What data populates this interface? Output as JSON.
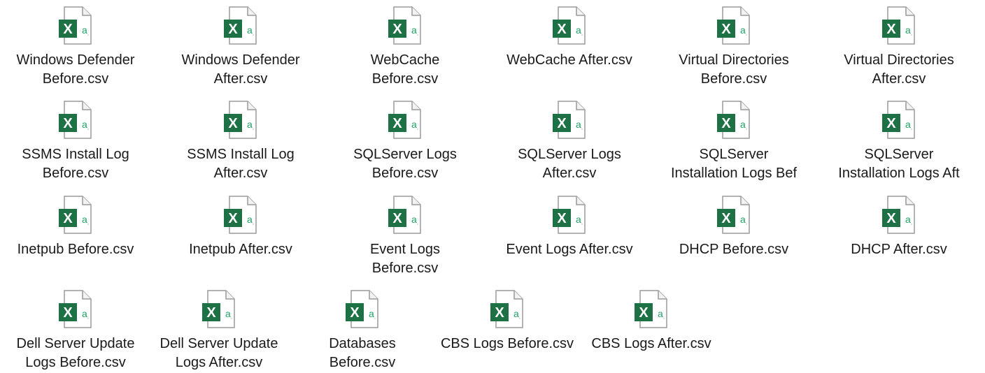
{
  "files": [
    {
      "label": "Windows Defender\nBefore.csv",
      "icon": "excel-csv-icon"
    },
    {
      "label": "Windows Defender\nAfter.csv",
      "icon": "excel-csv-icon"
    },
    {
      "label": "WebCache\nBefore.csv",
      "icon": "excel-csv-icon"
    },
    {
      "label": "WebCache After.csv",
      "icon": "excel-csv-icon"
    },
    {
      "label": "Virtual Directories\nBefore.csv",
      "icon": "excel-csv-icon"
    },
    {
      "label": "Virtual Directories\nAfter.csv",
      "icon": "excel-csv-icon"
    },
    {
      "label": "SSMS Install Log\nBefore.csv",
      "icon": "excel-csv-icon"
    },
    {
      "label": "SSMS Install Log\nAfter.csv",
      "icon": "excel-csv-icon"
    },
    {
      "label": "SQLServer Logs\nBefore.csv",
      "icon": "excel-csv-icon"
    },
    {
      "label": "SQLServer Logs\nAfter.csv",
      "icon": "excel-csv-icon"
    },
    {
      "label": "SQLServer\nInstallation Logs Bef",
      "icon": "excel-csv-icon"
    },
    {
      "label": "SQLServer\nInstallation Logs Aft",
      "icon": "excel-csv-icon"
    },
    {
      "label": "Inetpub Before.csv",
      "icon": "excel-csv-icon"
    },
    {
      "label": "Inetpub After.csv",
      "icon": "excel-csv-icon"
    },
    {
      "label": "Event Logs\nBefore.csv",
      "icon": "excel-csv-icon"
    },
    {
      "label": "Event Logs After.csv",
      "icon": "excel-csv-icon"
    },
    {
      "label": "DHCP Before.csv",
      "icon": "excel-csv-icon"
    },
    {
      "label": "DHCP After.csv",
      "icon": "excel-csv-icon"
    },
    {
      "label": "Dell Server Update\nLogs Before.csv",
      "icon": "excel-csv-icon"
    },
    {
      "label": "Dell Server Update\nLogs After.csv",
      "icon": "excel-csv-icon"
    },
    {
      "label": "Databases\nBefore.csv",
      "icon": "excel-csv-icon"
    },
    {
      "label": "CBS Logs Before.csv",
      "icon": "excel-csv-icon"
    },
    {
      "label": "CBS Logs After.csv",
      "icon": "excel-csv-icon"
    }
  ],
  "colors": {
    "excel_green": "#1e7145",
    "excel_green_light": "#21a366",
    "page_outline": "#9a9a9a",
    "text": "#1a1a1a"
  }
}
